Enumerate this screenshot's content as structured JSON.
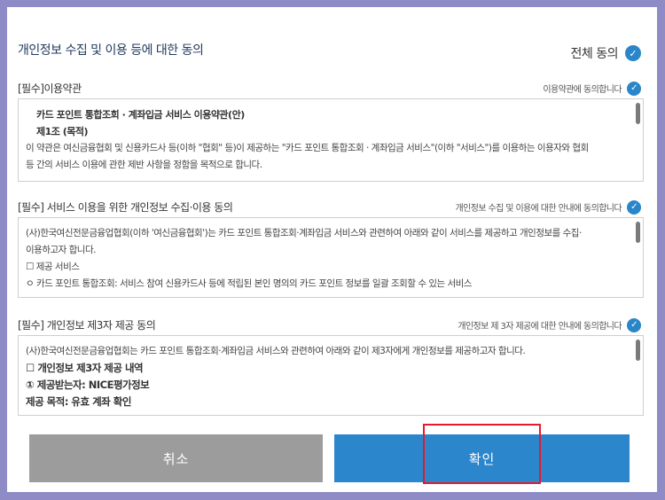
{
  "dialog": {
    "title": "개인정보 수집 및 이용 등에 대한 동의",
    "all_agree_label": "전체 동의"
  },
  "sections": [
    {
      "heading": "[필수]이용약관",
      "agree_text": "이용약관에 동의합니다",
      "lines": [
        "카드 포인트 통합조회 · 계좌입금 서비스 이용약관(안)",
        "제1조 (목적)",
        "이 약관은 여신금융협회 및 신용카드사 등(이하 \"협회\" 등)이 제공하는 \"카드 포인트 통합조회 · 계좌입금 서비스\"(이하 \"서비스\")를 이용하는 이용자와 협회",
        "등 간의 서비스 이용에 관한 제반 사항을 정함을 목적으로 합니다."
      ]
    },
    {
      "heading": "[필수] 서비스 이용을 위한 개인정보 수집·이용 동의",
      "agree_text": "개인정보 수집 및 이용에 대한 안내에 동의합니다",
      "lines": [
        "(사)한국여신전문금융업협회(이하 '여신금융협회')는 카드 포인트 통합조회·계좌입금 서비스와 관련하여 아래와 같이 서비스를 제공하고 개인정보를 수집·",
        "이용하고자 합니다.",
        "☐ 제공 서비스",
        "ㅇ 카드 포인트 통합조회: 서비스 참여 신용카드사 등에 적립된 본인 명의의 카드 포인트 정보를 일괄 조회할 수 있는 서비스"
      ]
    },
    {
      "heading": "[필수] 개인정보 제3자 제공 동의",
      "agree_text": "개인정보 제 3자 제공에 대한 안내에 동의합니다",
      "lines": [
        "(사)한국여신전문금융업협회는 카드 포인트 통합조회·계좌입금 서비스와 관련하여 아래와 같이 제3자에게 개인정보를 제공하고자 합니다.",
        "☐ 개인정보 제3자 제공 내역",
        "① 제공받는자: NICE평가정보",
        "제공 목적: 유효 계좌 확인"
      ]
    }
  ],
  "buttons": {
    "cancel": "취소",
    "confirm": "확인"
  },
  "colors": {
    "accent": "#2b86cc",
    "cancel": "#9c9c9c",
    "highlight": "#e8192c",
    "frame": "#8f8bc7"
  }
}
